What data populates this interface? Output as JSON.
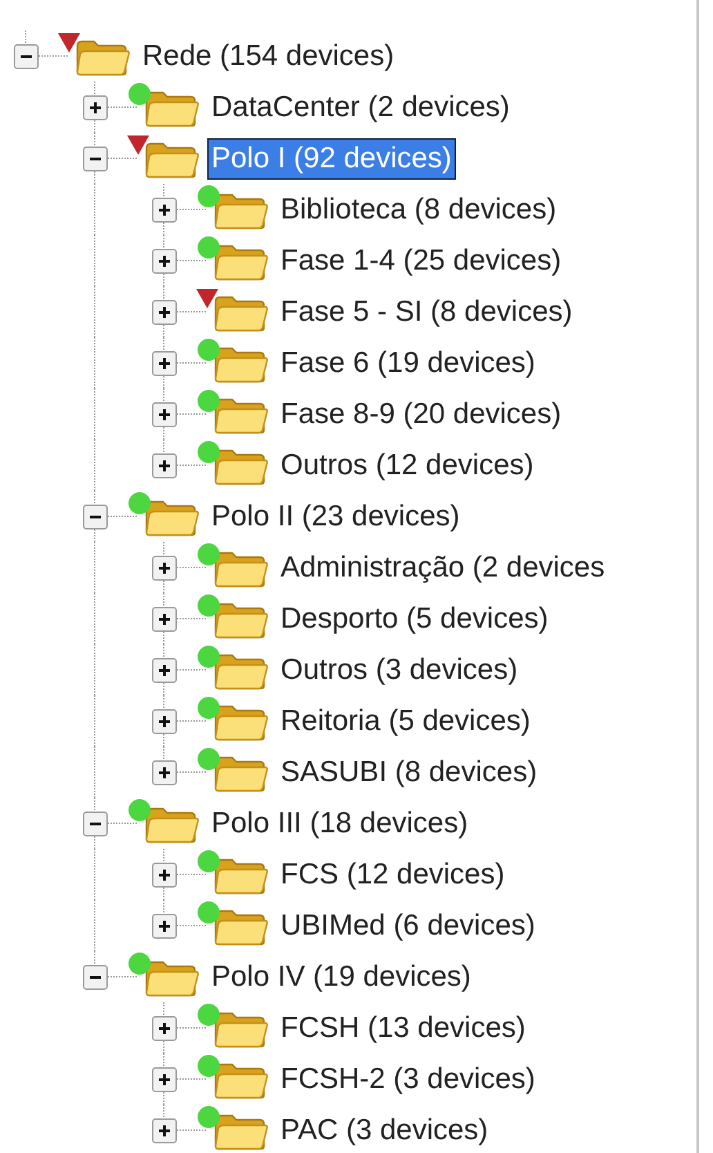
{
  "tree": [
    {
      "label": "Rede (154 devices)",
      "kind": "down",
      "expanded": true,
      "selected": false,
      "children": [
        {
          "label": "DataCenter (2 devices)",
          "kind": "up",
          "expanded": false,
          "selected": false
        },
        {
          "label": "Polo I (92 devices)",
          "kind": "down",
          "expanded": true,
          "selected": true,
          "children": [
            {
              "label": "Biblioteca (8 devices)",
              "kind": "up",
              "expanded": false,
              "selected": false
            },
            {
              "label": "Fase 1-4 (25 devices)",
              "kind": "up",
              "expanded": false,
              "selected": false
            },
            {
              "label": "Fase 5 - SI (8 devices)",
              "kind": "down",
              "expanded": false,
              "selected": false
            },
            {
              "label": "Fase 6 (19 devices)",
              "kind": "up",
              "expanded": false,
              "selected": false
            },
            {
              "label": "Fase 8-9 (20 devices)",
              "kind": "up",
              "expanded": false,
              "selected": false
            },
            {
              "label": "Outros (12 devices)",
              "kind": "up",
              "expanded": false,
              "selected": false
            }
          ]
        },
        {
          "label": "Polo II (23 devices)",
          "kind": "up",
          "expanded": true,
          "selected": false,
          "children": [
            {
              "label": "Administração (2 devices",
              "kind": "up",
              "expanded": false,
              "selected": false
            },
            {
              "label": "Desporto (5 devices)",
              "kind": "up",
              "expanded": false,
              "selected": false
            },
            {
              "label": "Outros (3 devices)",
              "kind": "up",
              "expanded": false,
              "selected": false
            },
            {
              "label": "Reitoria (5 devices)",
              "kind": "up",
              "expanded": false,
              "selected": false
            },
            {
              "label": "SASUBI (8 devices)",
              "kind": "up",
              "expanded": false,
              "selected": false
            }
          ]
        },
        {
          "label": "Polo III (18 devices)",
          "kind": "up",
          "expanded": true,
          "selected": false,
          "children": [
            {
              "label": "FCS (12 devices)",
              "kind": "up",
              "expanded": false,
              "selected": false
            },
            {
              "label": "UBIMed (6 devices)",
              "kind": "up",
              "expanded": false,
              "selected": false
            }
          ]
        },
        {
          "label": "Polo IV (19 devices)",
          "kind": "up",
          "expanded": true,
          "selected": false,
          "children": [
            {
              "label": "FCSH (13 devices)",
              "kind": "up",
              "expanded": false,
              "selected": false
            },
            {
              "label": "FCSH-2 (3 devices)",
              "kind": "up",
              "expanded": false,
              "selected": false
            },
            {
              "label": "PAC (3 devices)",
              "kind": "up",
              "expanded": false,
              "selected": false
            }
          ]
        }
      ]
    }
  ]
}
